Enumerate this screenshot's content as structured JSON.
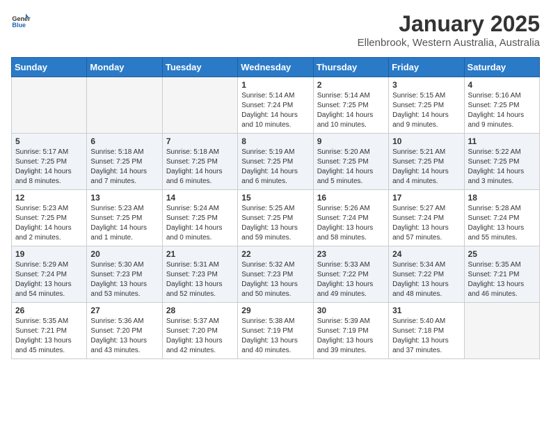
{
  "logo": {
    "general": "General",
    "blue": "Blue"
  },
  "header": {
    "month": "January 2025",
    "location": "Ellenbrook, Western Australia, Australia"
  },
  "weekdays": [
    "Sunday",
    "Monday",
    "Tuesday",
    "Wednesday",
    "Thursday",
    "Friday",
    "Saturday"
  ],
  "weeks": [
    [
      {
        "day": "",
        "info": ""
      },
      {
        "day": "",
        "info": ""
      },
      {
        "day": "",
        "info": ""
      },
      {
        "day": "1",
        "info": "Sunrise: 5:14 AM\nSunset: 7:24 PM\nDaylight: 14 hours\nand 10 minutes."
      },
      {
        "day": "2",
        "info": "Sunrise: 5:14 AM\nSunset: 7:25 PM\nDaylight: 14 hours\nand 10 minutes."
      },
      {
        "day": "3",
        "info": "Sunrise: 5:15 AM\nSunset: 7:25 PM\nDaylight: 14 hours\nand 9 minutes."
      },
      {
        "day": "4",
        "info": "Sunrise: 5:16 AM\nSunset: 7:25 PM\nDaylight: 14 hours\nand 9 minutes."
      }
    ],
    [
      {
        "day": "5",
        "info": "Sunrise: 5:17 AM\nSunset: 7:25 PM\nDaylight: 14 hours\nand 8 minutes."
      },
      {
        "day": "6",
        "info": "Sunrise: 5:18 AM\nSunset: 7:25 PM\nDaylight: 14 hours\nand 7 minutes."
      },
      {
        "day": "7",
        "info": "Sunrise: 5:18 AM\nSunset: 7:25 PM\nDaylight: 14 hours\nand 6 minutes."
      },
      {
        "day": "8",
        "info": "Sunrise: 5:19 AM\nSunset: 7:25 PM\nDaylight: 14 hours\nand 6 minutes."
      },
      {
        "day": "9",
        "info": "Sunrise: 5:20 AM\nSunset: 7:25 PM\nDaylight: 14 hours\nand 5 minutes."
      },
      {
        "day": "10",
        "info": "Sunrise: 5:21 AM\nSunset: 7:25 PM\nDaylight: 14 hours\nand 4 minutes."
      },
      {
        "day": "11",
        "info": "Sunrise: 5:22 AM\nSunset: 7:25 PM\nDaylight: 14 hours\nand 3 minutes."
      }
    ],
    [
      {
        "day": "12",
        "info": "Sunrise: 5:23 AM\nSunset: 7:25 PM\nDaylight: 14 hours\nand 2 minutes."
      },
      {
        "day": "13",
        "info": "Sunrise: 5:23 AM\nSunset: 7:25 PM\nDaylight: 14 hours\nand 1 minute."
      },
      {
        "day": "14",
        "info": "Sunrise: 5:24 AM\nSunset: 7:25 PM\nDaylight: 14 hours\nand 0 minutes."
      },
      {
        "day": "15",
        "info": "Sunrise: 5:25 AM\nSunset: 7:25 PM\nDaylight: 13 hours\nand 59 minutes."
      },
      {
        "day": "16",
        "info": "Sunrise: 5:26 AM\nSunset: 7:24 PM\nDaylight: 13 hours\nand 58 minutes."
      },
      {
        "day": "17",
        "info": "Sunrise: 5:27 AM\nSunset: 7:24 PM\nDaylight: 13 hours\nand 57 minutes."
      },
      {
        "day": "18",
        "info": "Sunrise: 5:28 AM\nSunset: 7:24 PM\nDaylight: 13 hours\nand 55 minutes."
      }
    ],
    [
      {
        "day": "19",
        "info": "Sunrise: 5:29 AM\nSunset: 7:24 PM\nDaylight: 13 hours\nand 54 minutes."
      },
      {
        "day": "20",
        "info": "Sunrise: 5:30 AM\nSunset: 7:23 PM\nDaylight: 13 hours\nand 53 minutes."
      },
      {
        "day": "21",
        "info": "Sunrise: 5:31 AM\nSunset: 7:23 PM\nDaylight: 13 hours\nand 52 minutes."
      },
      {
        "day": "22",
        "info": "Sunrise: 5:32 AM\nSunset: 7:23 PM\nDaylight: 13 hours\nand 50 minutes."
      },
      {
        "day": "23",
        "info": "Sunrise: 5:33 AM\nSunset: 7:22 PM\nDaylight: 13 hours\nand 49 minutes."
      },
      {
        "day": "24",
        "info": "Sunrise: 5:34 AM\nSunset: 7:22 PM\nDaylight: 13 hours\nand 48 minutes."
      },
      {
        "day": "25",
        "info": "Sunrise: 5:35 AM\nSunset: 7:21 PM\nDaylight: 13 hours\nand 46 minutes."
      }
    ],
    [
      {
        "day": "26",
        "info": "Sunrise: 5:35 AM\nSunset: 7:21 PM\nDaylight: 13 hours\nand 45 minutes."
      },
      {
        "day": "27",
        "info": "Sunrise: 5:36 AM\nSunset: 7:20 PM\nDaylight: 13 hours\nand 43 minutes."
      },
      {
        "day": "28",
        "info": "Sunrise: 5:37 AM\nSunset: 7:20 PM\nDaylight: 13 hours\nand 42 minutes."
      },
      {
        "day": "29",
        "info": "Sunrise: 5:38 AM\nSunset: 7:19 PM\nDaylight: 13 hours\nand 40 minutes."
      },
      {
        "day": "30",
        "info": "Sunrise: 5:39 AM\nSunset: 7:19 PM\nDaylight: 13 hours\nand 39 minutes."
      },
      {
        "day": "31",
        "info": "Sunrise: 5:40 AM\nSunset: 7:18 PM\nDaylight: 13 hours\nand 37 minutes."
      },
      {
        "day": "",
        "info": ""
      }
    ]
  ]
}
